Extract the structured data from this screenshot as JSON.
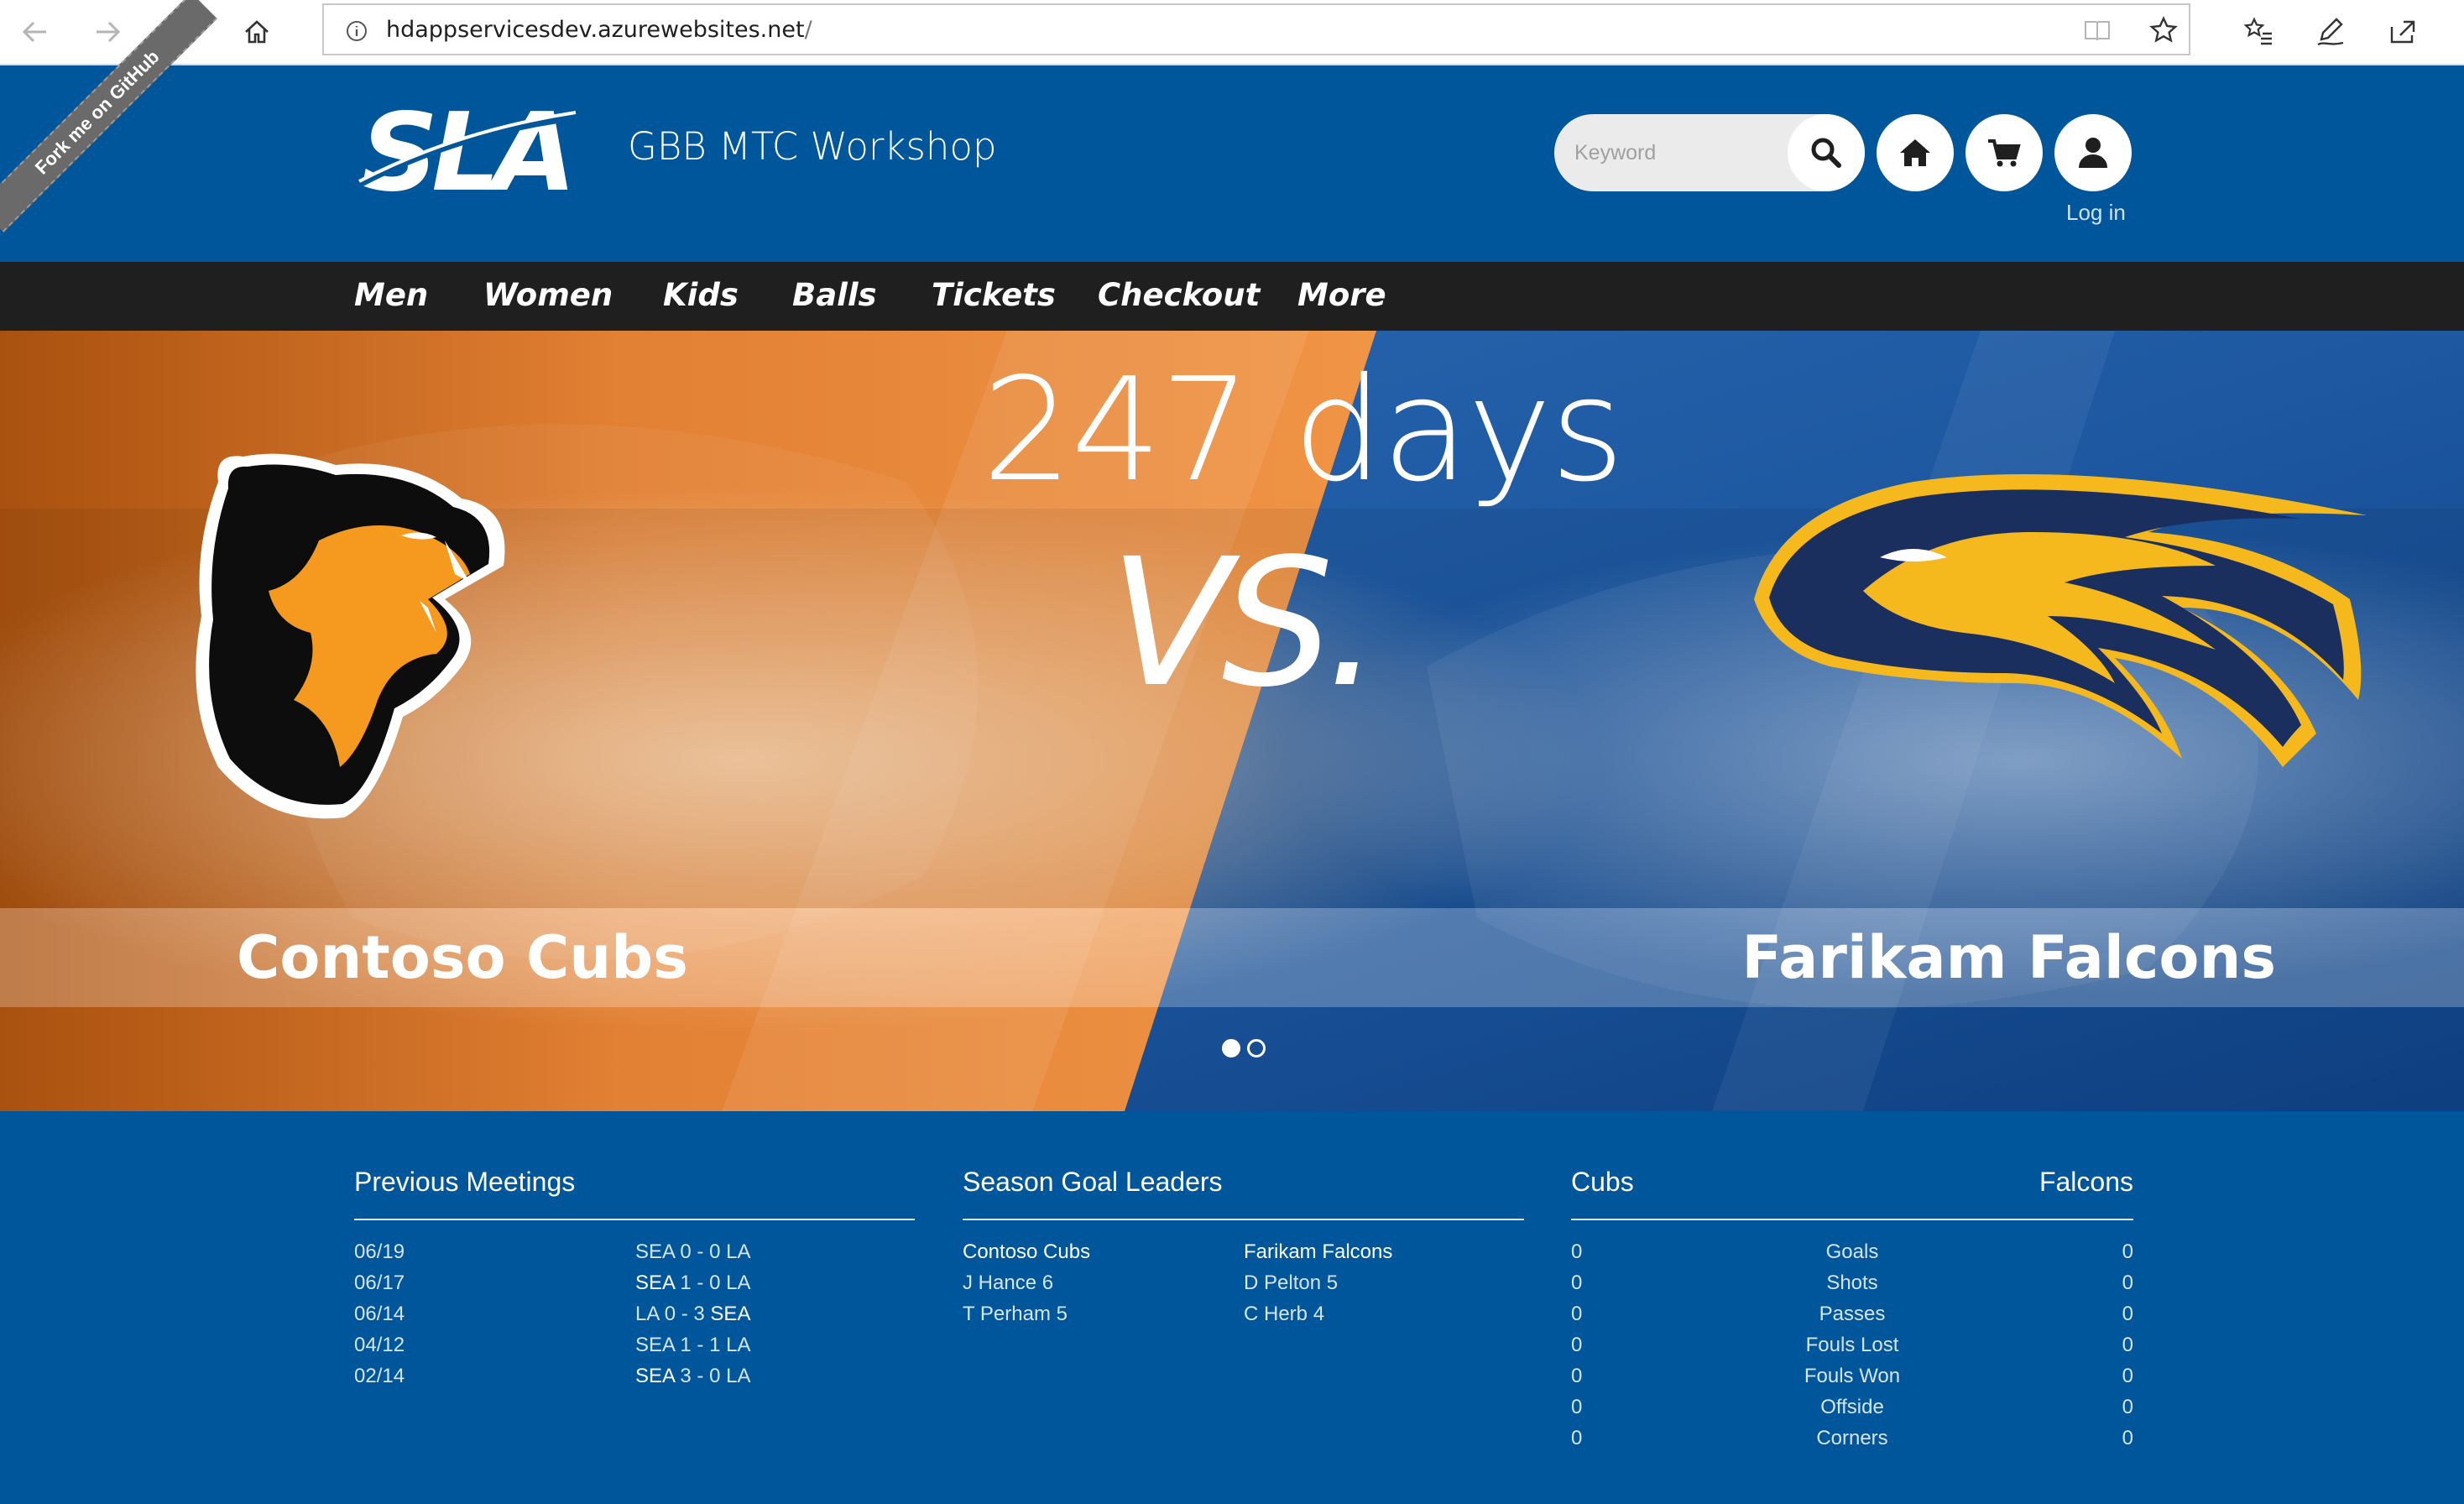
{
  "browser": {
    "url_host": "hdappservicesdev.azurewebsites.net",
    "url_path": "/"
  },
  "header": {
    "logo_text": "SLA",
    "site_title": "GBB MTC Workshop",
    "search_placeholder": "Keyword",
    "login_label": "Log in",
    "ribbon_text": "Fork me on GitHub"
  },
  "menu": [
    "Men",
    "Women",
    "Kids",
    "Balls",
    "Tickets",
    "Checkout",
    "More"
  ],
  "hero": {
    "countdown": "247 days",
    "vs": "VS.",
    "home_team": "Contoso Cubs",
    "away_team": "Farikam Falcons",
    "carousel_total": 2,
    "carousel_active": 1,
    "colors": {
      "home": "#e8843a",
      "away": "#1f5aa3"
    }
  },
  "previous_meetings": {
    "title": "Previous Meetings",
    "rows": [
      {
        "date": "06/19",
        "home": "SEA",
        "home_score": "0",
        "away_score": "0",
        "away": "LA",
        "winner": ""
      },
      {
        "date": "06/17",
        "home": "SEA",
        "home_score": "1",
        "away_score": "0",
        "away": "LA",
        "winner": "home"
      },
      {
        "date": "06/14",
        "home": "LA",
        "home_score": "0",
        "away_score": "3",
        "away": "SEA",
        "winner": "away"
      },
      {
        "date": "04/12",
        "home": "SEA",
        "home_score": "1",
        "away_score": "1",
        "away": "LA",
        "winner": ""
      },
      {
        "date": "02/14",
        "home": "SEA",
        "home_score": "3",
        "away_score": "0",
        "away": "LA",
        "winner": "home"
      }
    ]
  },
  "goal_leaders": {
    "title": "Season Goal Leaders",
    "home_label": "Contoso Cubs",
    "away_label": "Farikam Falcons",
    "home": [
      "J Hance 6",
      "T Perham 5"
    ],
    "away": [
      "D Pelton 5",
      "C Herb 4"
    ]
  },
  "team_stats": {
    "home_label": "Cubs",
    "away_label": "Falcons",
    "rows": [
      {
        "label": "Goals",
        "home": "0",
        "away": "0"
      },
      {
        "label": "Shots",
        "home": "0",
        "away": "0"
      },
      {
        "label": "Passes",
        "home": "0",
        "away": "0"
      },
      {
        "label": "Fouls Lost",
        "home": "0",
        "away": "0"
      },
      {
        "label": "Fouls Won",
        "home": "0",
        "away": "0"
      },
      {
        "label": "Offside",
        "home": "0",
        "away": "0"
      },
      {
        "label": "Corners",
        "home": "0",
        "away": "0"
      }
    ]
  }
}
